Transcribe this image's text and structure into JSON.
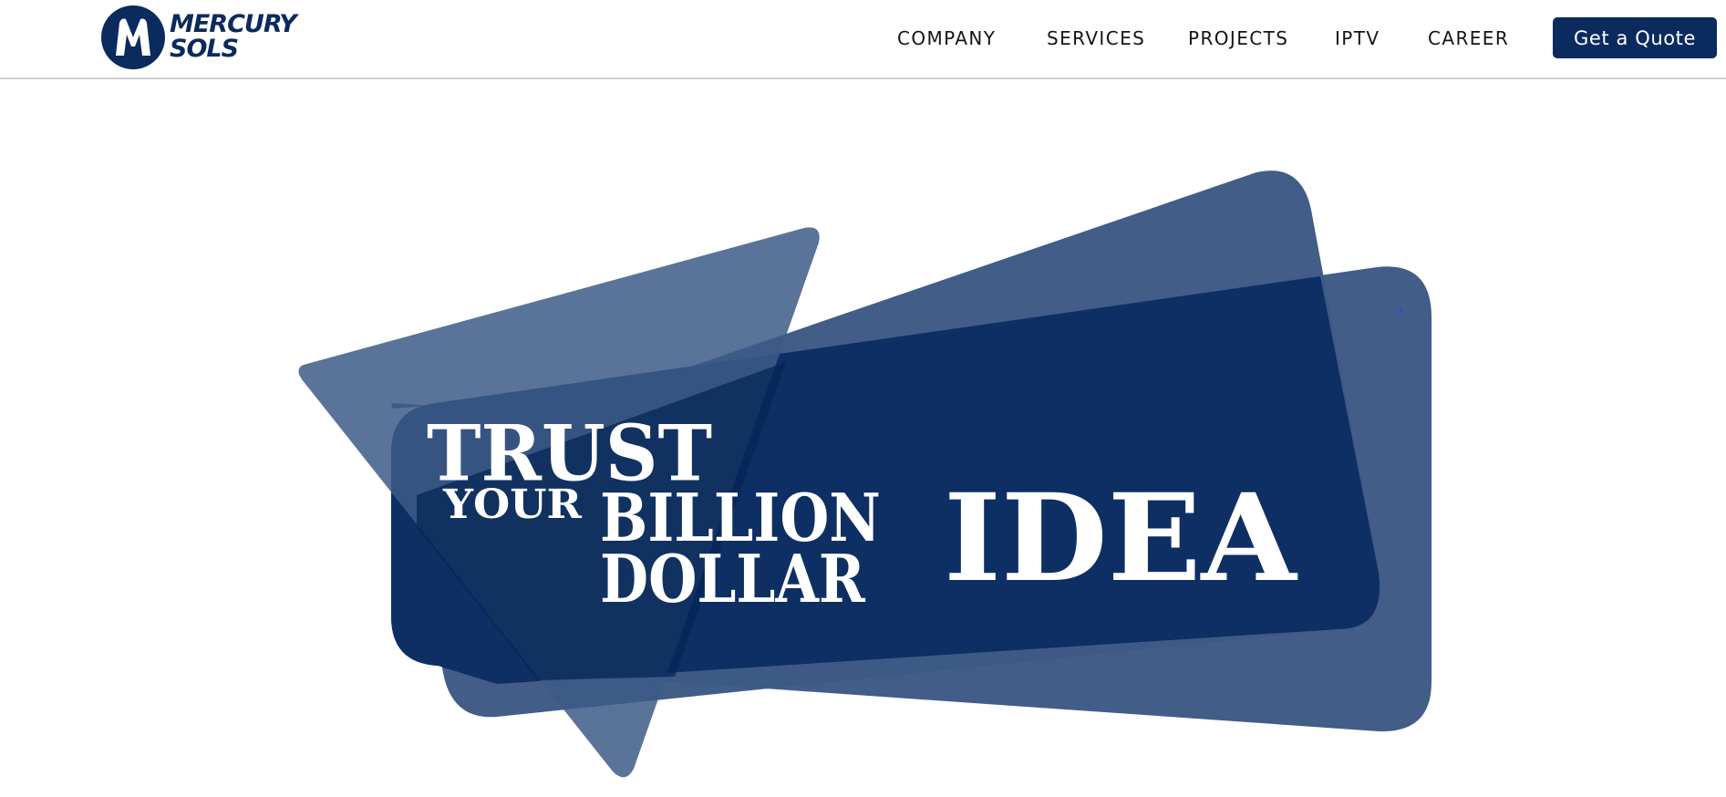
{
  "brand": {
    "name_line1": "MERCURY",
    "name_line2": "SOLS",
    "badge_letter": "M",
    "color": "#0b2a5e"
  },
  "nav": {
    "items": [
      {
        "label": "COMPANY"
      },
      {
        "label": "SERVICES"
      },
      {
        "label": "PROJECTS"
      },
      {
        "label": "IPTV"
      },
      {
        "label": "CAREER"
      }
    ],
    "cta_label": "Get a Quote"
  },
  "hero": {
    "headline": {
      "trust": "TRUST",
      "your": "YOUR",
      "billion": "BILLION",
      "dollar": "DOLLAR",
      "idea": "IDEA"
    },
    "shape_colors": {
      "light": "#3d5a86",
      "dark": "#0b2a5e"
    }
  }
}
